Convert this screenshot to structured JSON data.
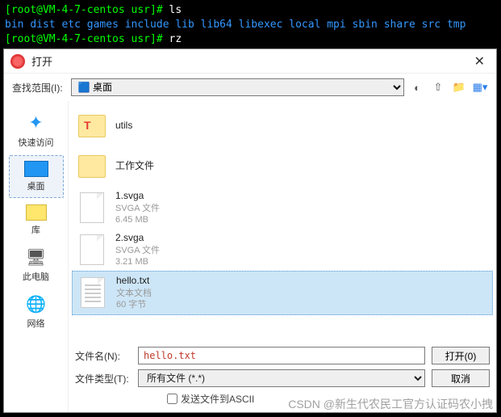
{
  "terminal": {
    "line1_prompt": "[root@VM-4-7-centos usr]#",
    "line1_cmd": "ls",
    "dirs": [
      "bin",
      "dist",
      "etc",
      "games",
      "include",
      "lib",
      "lib64",
      "libexec",
      "local",
      "mpi",
      "sbin",
      "share",
      "src",
      "tmp"
    ],
    "line3_prompt": "[root@VM-4-7-centos usr]#",
    "line3_cmd": "rz"
  },
  "dialog": {
    "title": "打开",
    "lookin_label": "查找范围(I):",
    "lookin_value": "桌面",
    "places": {
      "quick": "快速访问",
      "desktop": "桌面",
      "library": "库",
      "thispc": "此电脑",
      "network": "网络"
    },
    "files": [
      {
        "name": "utils",
        "meta1": "",
        "meta2": "",
        "kind": "folder-red"
      },
      {
        "name": "工作文件",
        "meta1": "",
        "meta2": "",
        "kind": "folder"
      },
      {
        "name": "1.svga",
        "meta1": "SVGA 文件",
        "meta2": "6.45 MB",
        "kind": "doc"
      },
      {
        "name": "2.svga",
        "meta1": "SVGA 文件",
        "meta2": "3.21 MB",
        "kind": "doc"
      },
      {
        "name": "hello.txt",
        "meta1": "文本文档",
        "meta2": "60 字节",
        "kind": "txt",
        "selected": true
      }
    ],
    "filename_label": "文件名(N):",
    "filename_value": "hello.txt",
    "filetype_label": "文件类型(T):",
    "filetype_value": "所有文件 (*.*)",
    "open_btn": "打开(0)",
    "cancel_btn": "取消",
    "ascii_checkbox": "发送文件到ASCII"
  },
  "watermark": "CSDN @新生代农民工官方认证码农小拽"
}
